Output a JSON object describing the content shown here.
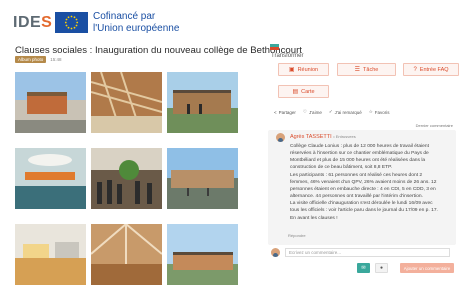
{
  "header": {
    "logo_text": "IDE",
    "logo_accent": "S",
    "cofinance_line1": "Cofinancé par",
    "cofinance_line2": "l'Union européenne"
  },
  "album": {
    "title": "Clauses sociales : Inauguration du nouveau collège de Bethoncourt",
    "badge": "Album photo",
    "time": "15:48"
  },
  "feed": {
    "transformer_label": "Transformer",
    "buttons": {
      "reunion": "Réunion",
      "tache": "Tâche",
      "entree_faq": "Entrée FAQ",
      "carte": "Carte"
    },
    "reactions": {
      "partager": "Partager",
      "jaime": "J'aime",
      "jai_remarque": "J'ai remarqué",
      "favoris": "Favoris"
    },
    "dernier": "Dernier commentaire",
    "comment": {
      "author": "Agrès TASSETTI",
      "author_suffix": "• Entrusvees",
      "lines": [
        "Collège Claude Lonius : plus de 12 000 heures de travail étaient",
        "réservées à l'insertion sur ce chantier emblématique du Pays de",
        "Montbéliard et plus de 15 000 heures ont été réalisées dans la",
        "construction de ce beau bâtiment, soit 8,8 ETP.",
        "Les participants : 61 personnes ont réalisé ces heures dont 2",
        "femmes, 46% venaient d'un QPV, 26% avaient moins de 26 ans. 12",
        "personnes étaient en embauche directe : 4 en CDI, 5 en CDD, 3 en",
        "alternance. 44 personnes ont travaillé par l'intérim d'insertion.",
        "La visite officielle d'inauguration s'est déroulée le lundi 16/09 avec",
        "tous les officiels : voir l'article paru dans le journal du 17/09 en p. 17.",
        "En avant les clauses !"
      ],
      "reply": "Répondre"
    },
    "input_placeholder": "Ecrivez un commentaire...",
    "add_comment": "Ajouter un commentaire"
  },
  "colors": {
    "accent": "#d94b2b",
    "eu_blue": "#1a4fa3",
    "teal": "#3aa89c"
  },
  "icons": [
    "comment-icon",
    "calendar-icon",
    "checklist-icon",
    "faq-icon",
    "map-icon",
    "share-icon",
    "like-icon",
    "check-icon",
    "star-icon",
    "user-icon",
    "send-icon"
  ]
}
